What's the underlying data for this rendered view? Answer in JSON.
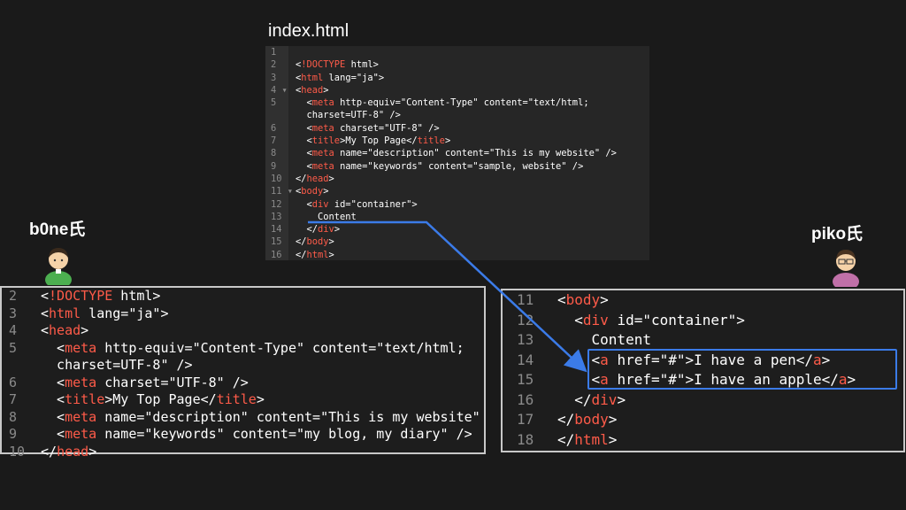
{
  "file_title": "index.html",
  "users": {
    "left": "b0ne氏",
    "right": "piko氏"
  },
  "top_editor": {
    "lines": [
      {
        "n": "1",
        "c": ""
      },
      {
        "n": "2",
        "c": "<!DOCTYPE html>"
      },
      {
        "n": "3",
        "c": "<html lang=\"ja\">"
      },
      {
        "n": "4 ▾",
        "c": "<head>"
      },
      {
        "n": "5",
        "c": "  <meta http-equiv=\"Content-Type\" content=\"text/html;"
      },
      {
        "n": "",
        "c": "  charset=UTF-8\" />"
      },
      {
        "n": "6",
        "c": "  <meta charset=\"UTF-8\" />"
      },
      {
        "n": "7",
        "c": "  <title>My Top Page</title>"
      },
      {
        "n": "8",
        "c": "  <meta name=\"description\" content=\"This is my website\" />"
      },
      {
        "n": "9",
        "c": "  <meta name=\"keywords\" content=\"sample, website\" />"
      },
      {
        "n": "10",
        "c": "</head>"
      },
      {
        "n": "11 ▾",
        "c": "<body>"
      },
      {
        "n": "12",
        "c": "  <div id=\"container\">"
      },
      {
        "n": "13",
        "c": "    Content"
      },
      {
        "n": "14",
        "c": "  </div>"
      },
      {
        "n": "15",
        "c": "</body>"
      },
      {
        "n": "16",
        "c": "</html>"
      }
    ]
  },
  "left_editor": {
    "lines": [
      {
        "n": "2",
        "c": "<!DOCTYPE html>"
      },
      {
        "n": "3",
        "c": "<html lang=\"ja\">"
      },
      {
        "n": "4",
        "c": "<head>"
      },
      {
        "n": "5",
        "c": "  <meta http-equiv=\"Content-Type\" content=\"text/html;"
      },
      {
        "n": "",
        "c": "  charset=UTF-8\" />"
      },
      {
        "n": "6",
        "c": "  <meta charset=\"UTF-8\" />"
      },
      {
        "n": "7",
        "c": "  <title>My Top Page</title>"
      },
      {
        "n": "8",
        "c": "  <meta name=\"description\" content=\"This is my website\""
      },
      {
        "n": "9",
        "c": "  <meta name=\"keywords\" content=\"my blog, my diary\" />"
      },
      {
        "n": "10",
        "c": "</head>"
      }
    ]
  },
  "right_editor": {
    "lines": [
      {
        "n": "11",
        "c": "<body>"
      },
      {
        "n": "12",
        "c": "  <div id=\"container\">"
      },
      {
        "n": "13",
        "c": "    Content"
      },
      {
        "n": "14",
        "c": "    <a href=\"#\">I have a pen</a>"
      },
      {
        "n": "15",
        "c": "    <a href=\"#\">I have an apple</a>"
      },
      {
        "n": "16",
        "c": "  </div>"
      },
      {
        "n": "17",
        "c": "</body>"
      },
      {
        "n": "18",
        "c": "</html>"
      }
    ]
  },
  "colors": {
    "tag": "#ff5b49",
    "attr": "#f0c674",
    "highlight": "#3b7be8"
  }
}
